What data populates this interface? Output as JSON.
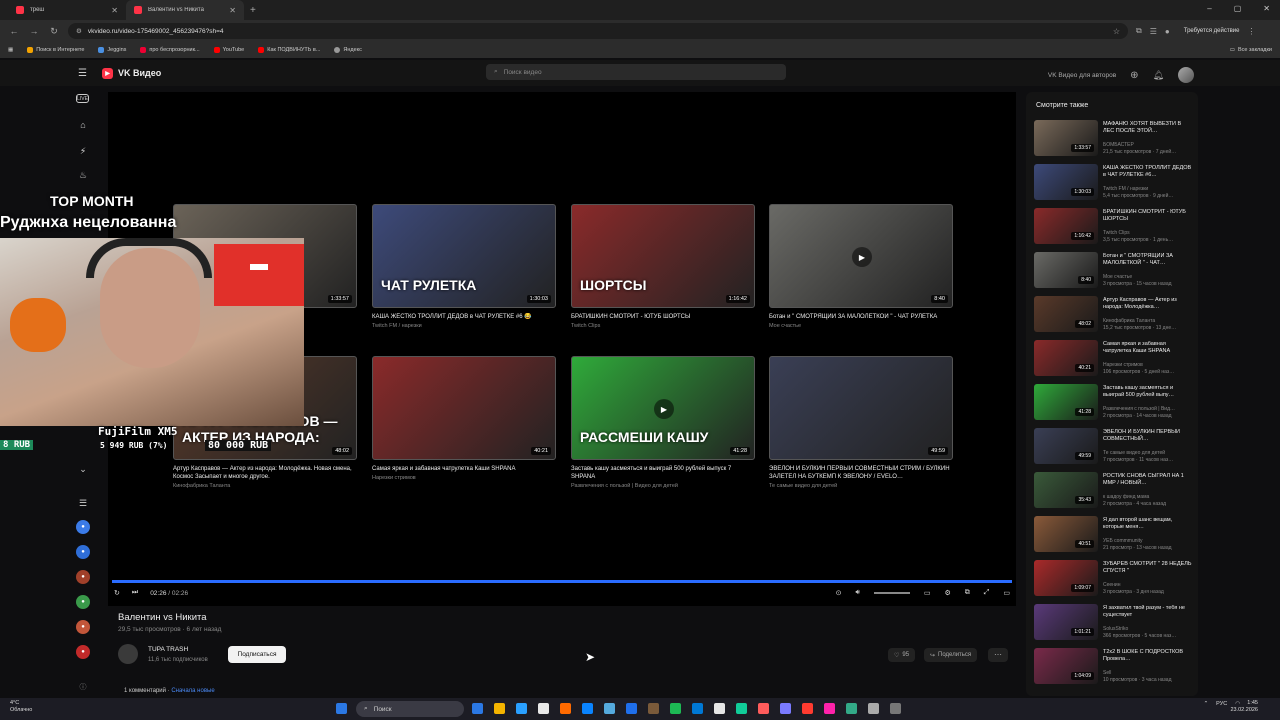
{
  "browser": {
    "tabs": [
      {
        "label": "треш"
      },
      {
        "label": "Валентин vs Никита"
      }
    ],
    "url": "vkvideo.ru/video-175469002_456239476?sh=4",
    "profile_status": "Требуется действие",
    "bookmarks": [
      "Поиск в Интернете",
      "Jeggins",
      "про беспрозорник...",
      "YouTube",
      "Как ПОДВИНУТЬ в...",
      "Яндекс"
    ],
    "all_bookmarks": "Все закладки"
  },
  "vk": {
    "logo": "VK Видео",
    "search_placeholder": "Поиск видео",
    "for_authors": "VK Видео для авторов"
  },
  "rail": {
    "live": "LIVE"
  },
  "end_cards": [
    {
      "title": "…Е ЭТОЙ",
      "meta": "",
      "duration": "1:33:57",
      "color": "#6b6358"
    },
    {
      "title": "КАША ЖЁСТКО ТРОЛЛИТ ДЕДОВ в ЧАТ РУЛЕТКЕ #6 😂",
      "meta": "Twitch FM / нарезки",
      "duration": "1:30:03",
      "color": "#3d4a7a",
      "overlay": "ЧАТ РУЛЕТКА"
    },
    {
      "title": "БРАТИШКИН СМОТРИТ - ЮТУБ ШОРТСЫ",
      "meta": "Twitch Clips",
      "duration": "1:16:42",
      "color": "#8a2a2a",
      "overlay": "ШОРТСЫ"
    },
    {
      "title": "Ботан и \" СМОТРЯЩИЙ ЗА МАЛОЛЕТКОЙ \" - ЧАТ РУЛЕТКА",
      "meta": "Мое счастье",
      "duration": "8:40",
      "color": "#6a6a66",
      "play": true
    },
    {
      "title": "Артур Касправов — Актер из народа: Молодёжка. Новая смена, Космос Засыпает и многое другое.",
      "meta": "Кинофабрика Таланта",
      "duration": "48:02",
      "color": "#5a3a2a",
      "overlay": "АРТУР КАСПРАНОВ — АКТЕР ИЗ НАРОДА:"
    },
    {
      "title": "Самая яркая и забавная чатрулетка Каши SHPANA",
      "meta": "Нарезки стримов",
      "duration": "40:21",
      "color": "#8a2a2a"
    },
    {
      "title": "Заставь кашу засмеяться и выиграй 500 рублей выпуск 7 SHPANA",
      "meta": "Развлечения с пользой | Видео для детей",
      "duration": "41:28",
      "color": "#2faa3a",
      "overlay": "РАССМЕШИ КАШУ",
      "play": true
    },
    {
      "title": "ЭВЕЛОН И БУЛКИН ПЕРВЫЙ СОВМЕСТНЫЙ СТРИМ / БУЛКИН ЗАЛЕТЕЛ НА БУТКЕМП К ЭВЕЛОНУ / EVELO…",
      "meta": "Те самые видео для детей",
      "duration": "49:59",
      "color": "#3a3f55"
    }
  ],
  "player": {
    "time_current": "02:26",
    "time_sep": " / ",
    "time_total": "02:26",
    "progress": 1.0
  },
  "stream_overlay": {
    "top_month": "TOP MONTH",
    "name": "Руджнха нецелованна",
    "camera": "FujiFilm XM5",
    "rub_left": "8 RUB",
    "rub_sum": "5 949 RUB (7%)",
    "rub_goal": "80 000 RUB"
  },
  "video": {
    "title": "Валентин vs Никита",
    "views": "29,5 тыс просмотров",
    "age": "6 лет назад",
    "channel": "TUPA TRASH",
    "subscribers": "11,6 тыс подписчиков",
    "subscribe_label": "Подписаться",
    "likes": "95",
    "share_label": "Поделиться",
    "comments_count": "1 комментарий",
    "sort_label": "Сначала новые"
  },
  "sidebar": {
    "header": "Смотрите также",
    "items": [
      {
        "title": "МАФАНЮ ХОТЯТ ВЫВЕЗТИ В ЛЕС ПОСЛЕ ЭТОЙ…",
        "channel": "БОМБАСТЕР",
        "views": "21,5 тыс просмотров · 7 дней…",
        "duration": "1:33:57",
        "color": "#7a6a5a"
      },
      {
        "title": "КАША ЖЁСТКО ТРОЛЛИТ ДЕДОВ в ЧАТ РУЛЕТКЕ #6…",
        "channel": "Twitch FM / нарезки",
        "views": "5,4 тыс просмотров · 9 дней…",
        "duration": "1:30:03",
        "color": "#3d4a7a"
      },
      {
        "title": "БРАТИШКИН СМОТРИТ - ЮТУБ ШОРТСЫ",
        "channel": "Twitch Clips",
        "views": "3,5 тыс просмотров · 1 день…",
        "duration": "1:16:42",
        "color": "#8a2a2a"
      },
      {
        "title": "Ботан и \" СМОТРЯЩИЙ ЗА МАЛОЛЕТКОЙ \" - ЧАТ…",
        "channel": "Мое счастье",
        "views": "3 просмотра · 15 часов назад",
        "duration": "8:40",
        "color": "#6a6a66"
      },
      {
        "title": "Артур Касправов — Актер из народа: Молодёжка…",
        "channel": "Кинофабрика Таланта",
        "views": "15,2 тыс просмотров · 13 дне…",
        "duration": "48:02",
        "color": "#5a3a2a"
      },
      {
        "title": "Самая яркая и забавная чатрулетка Каши SHPANA",
        "channel": "Нарезки стримов",
        "views": "106 просмотров · 5 дней наз…",
        "duration": "40:21",
        "color": "#8a2a2a"
      },
      {
        "title": "Заставь кашу засмеяться и выиграй 500 рублей выпу…",
        "channel": "Развлечения с пользой | Вид…",
        "views": "2 просмотра · 14 часов назад",
        "duration": "41:28",
        "color": "#2faa3a"
      },
      {
        "title": "ЭВЕЛОН И БУЛКИН ПЕРВЫЙ СОВМЕСТНЫЙ…",
        "channel": "Те самые видео для детей",
        "views": "7 просмотров · 11 часов наз…",
        "duration": "49:59",
        "color": "#3a3f55"
      },
      {
        "title": "РОСТИК СНОВА СЫГРАЛ НА 1 ММР / НОВЫЙ…",
        "channel": "к шадоу финд мама",
        "views": "2 просмотра · 4 часа назад",
        "duration": "35:43",
        "color": "#3a5a3a"
      },
      {
        "title": "Я дал второй шанс вещам, которые меня…",
        "channel": "УЕБ commmunity",
        "views": "21 просмотр · 13 часов назад",
        "duration": "40:51",
        "color": "#8a5a3a"
      },
      {
        "title": "ЗУБАРЕВ СМОТРИТ \" 28 НЕДЕЛЬ СПУСТЯ \"",
        "channel": "Сеенин",
        "views": "3 просмотра · 3 дня назад",
        "duration": "1:09:07",
        "color": "#aa2a2a"
      },
      {
        "title": "Я захватил твой разум - тебя не существует",
        "channel": "SolusStriko",
        "views": "366 просмотров · 5 часов наз…",
        "duration": "1:01:21",
        "color": "#5a3a7a"
      },
      {
        "title": "T2x2 В ШОКЕ С ПОДРОСТКОВ Провела…",
        "channel": "Sell",
        "views": "10 просмотров · 3 часа назад",
        "duration": "1:04:09",
        "color": "#7a2a4a"
      }
    ]
  },
  "taskbar": {
    "temp": "4°C",
    "weather": "Облачно",
    "search": "Поиск",
    "lang": "РУС",
    "time": "1:45",
    "date": "23.02.2026",
    "colors": [
      "#2b78e4",
      "#f4b400",
      "#2aa0ff",
      "#e8e8e8",
      "#ff6a00",
      "#0a84ff",
      "#5ad",
      "#1f6feb",
      "#7a5a3a",
      "#1db954",
      "#0078d4",
      "#e6e6e6",
      "#1c9",
      "#ff5c5c",
      "#7a7aff",
      "#ff3b30",
      "#f2a",
      "#3a8",
      "#aaa",
      "#777"
    ]
  }
}
